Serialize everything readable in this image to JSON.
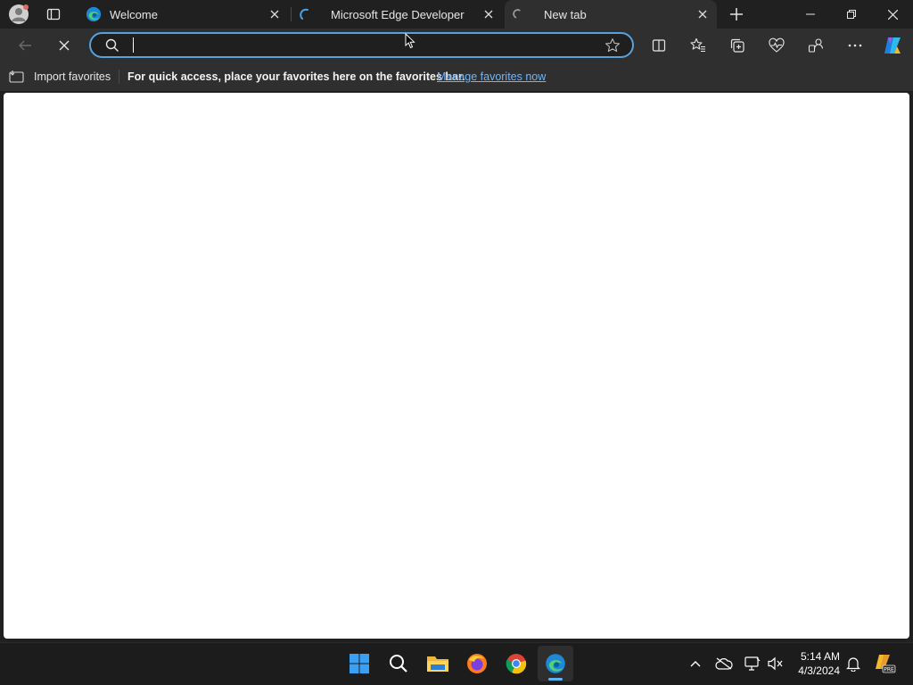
{
  "tabs": [
    {
      "title": "Welcome"
    },
    {
      "title": "Microsoft Edge Developer"
    },
    {
      "title": "New tab"
    }
  ],
  "address_bar": {
    "value": "",
    "placeholder": ""
  },
  "favorites_bar": {
    "import_label": "Import favorites",
    "message": "For quick access, place your favorites here on the favorites bar.",
    "manage_link": "Manage favorites now"
  },
  "system_tray": {
    "time": "5:14 AM",
    "date": "4/3/2024"
  },
  "colors": {
    "accent": "#5aa1d9",
    "link": "#6cb6ff",
    "chrome": "#2f2f2f"
  }
}
